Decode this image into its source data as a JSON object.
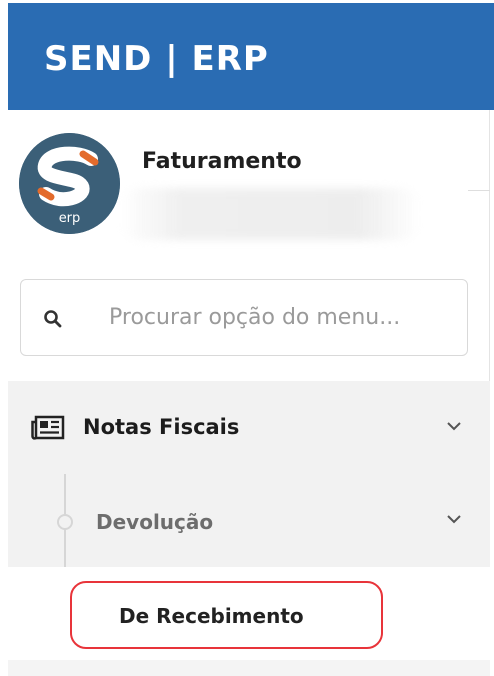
{
  "header": {
    "brand": "SEND | ERP"
  },
  "profile": {
    "avatar_icon": "send-erp-logo",
    "avatar_text": "erp",
    "name": "Faturamento"
  },
  "search": {
    "placeholder": "Procurar opção do menu...",
    "value": ""
  },
  "menu": {
    "group": {
      "label": "Notas Fiscais",
      "icon": "newspaper-icon",
      "expanded": true
    },
    "subgroup": {
      "label": "Devolução",
      "expanded": true
    },
    "item": {
      "label": "De Recebimento",
      "highlighted": true
    }
  },
  "colors": {
    "header": "#2a6cb3",
    "avatar": "#3b5f78",
    "highlight_border": "#e8343a"
  }
}
